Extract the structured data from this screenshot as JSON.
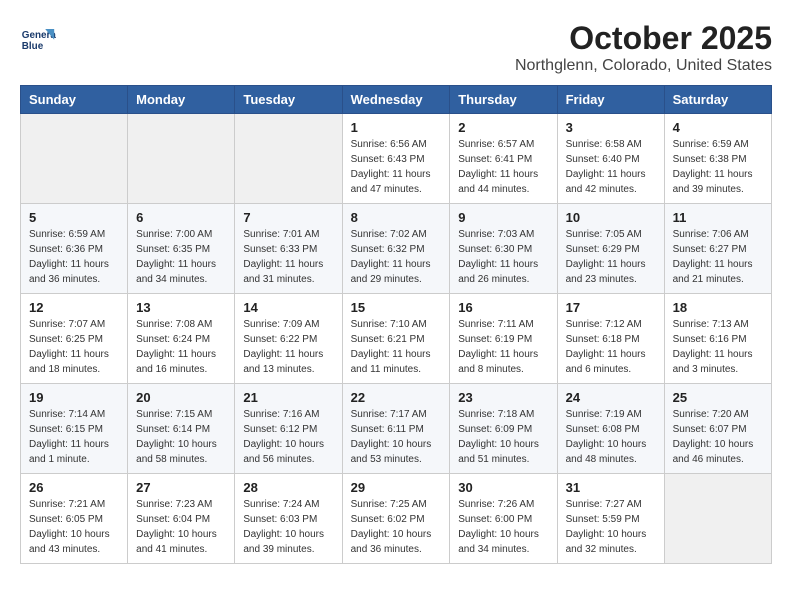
{
  "header": {
    "title": "October 2025",
    "subtitle": "Northglenn, Colorado, United States"
  },
  "logo": {
    "line1": "General",
    "line2": "Blue"
  },
  "days_of_week": [
    "Sunday",
    "Monday",
    "Tuesday",
    "Wednesday",
    "Thursday",
    "Friday",
    "Saturday"
  ],
  "weeks": [
    [
      {
        "day": "",
        "info": ""
      },
      {
        "day": "",
        "info": ""
      },
      {
        "day": "",
        "info": ""
      },
      {
        "day": "1",
        "info": "Sunrise: 6:56 AM\nSunset: 6:43 PM\nDaylight: 11 hours and 47 minutes."
      },
      {
        "day": "2",
        "info": "Sunrise: 6:57 AM\nSunset: 6:41 PM\nDaylight: 11 hours and 44 minutes."
      },
      {
        "day": "3",
        "info": "Sunrise: 6:58 AM\nSunset: 6:40 PM\nDaylight: 11 hours and 42 minutes."
      },
      {
        "day": "4",
        "info": "Sunrise: 6:59 AM\nSunset: 6:38 PM\nDaylight: 11 hours and 39 minutes."
      }
    ],
    [
      {
        "day": "5",
        "info": "Sunrise: 6:59 AM\nSunset: 6:36 PM\nDaylight: 11 hours and 36 minutes."
      },
      {
        "day": "6",
        "info": "Sunrise: 7:00 AM\nSunset: 6:35 PM\nDaylight: 11 hours and 34 minutes."
      },
      {
        "day": "7",
        "info": "Sunrise: 7:01 AM\nSunset: 6:33 PM\nDaylight: 11 hours and 31 minutes."
      },
      {
        "day": "8",
        "info": "Sunrise: 7:02 AM\nSunset: 6:32 PM\nDaylight: 11 hours and 29 minutes."
      },
      {
        "day": "9",
        "info": "Sunrise: 7:03 AM\nSunset: 6:30 PM\nDaylight: 11 hours and 26 minutes."
      },
      {
        "day": "10",
        "info": "Sunrise: 7:05 AM\nSunset: 6:29 PM\nDaylight: 11 hours and 23 minutes."
      },
      {
        "day": "11",
        "info": "Sunrise: 7:06 AM\nSunset: 6:27 PM\nDaylight: 11 hours and 21 minutes."
      }
    ],
    [
      {
        "day": "12",
        "info": "Sunrise: 7:07 AM\nSunset: 6:25 PM\nDaylight: 11 hours and 18 minutes."
      },
      {
        "day": "13",
        "info": "Sunrise: 7:08 AM\nSunset: 6:24 PM\nDaylight: 11 hours and 16 minutes."
      },
      {
        "day": "14",
        "info": "Sunrise: 7:09 AM\nSunset: 6:22 PM\nDaylight: 11 hours and 13 minutes."
      },
      {
        "day": "15",
        "info": "Sunrise: 7:10 AM\nSunset: 6:21 PM\nDaylight: 11 hours and 11 minutes."
      },
      {
        "day": "16",
        "info": "Sunrise: 7:11 AM\nSunset: 6:19 PM\nDaylight: 11 hours and 8 minutes."
      },
      {
        "day": "17",
        "info": "Sunrise: 7:12 AM\nSunset: 6:18 PM\nDaylight: 11 hours and 6 minutes."
      },
      {
        "day": "18",
        "info": "Sunrise: 7:13 AM\nSunset: 6:16 PM\nDaylight: 11 hours and 3 minutes."
      }
    ],
    [
      {
        "day": "19",
        "info": "Sunrise: 7:14 AM\nSunset: 6:15 PM\nDaylight: 11 hours and 1 minute."
      },
      {
        "day": "20",
        "info": "Sunrise: 7:15 AM\nSunset: 6:14 PM\nDaylight: 10 hours and 58 minutes."
      },
      {
        "day": "21",
        "info": "Sunrise: 7:16 AM\nSunset: 6:12 PM\nDaylight: 10 hours and 56 minutes."
      },
      {
        "day": "22",
        "info": "Sunrise: 7:17 AM\nSunset: 6:11 PM\nDaylight: 10 hours and 53 minutes."
      },
      {
        "day": "23",
        "info": "Sunrise: 7:18 AM\nSunset: 6:09 PM\nDaylight: 10 hours and 51 minutes."
      },
      {
        "day": "24",
        "info": "Sunrise: 7:19 AM\nSunset: 6:08 PM\nDaylight: 10 hours and 48 minutes."
      },
      {
        "day": "25",
        "info": "Sunrise: 7:20 AM\nSunset: 6:07 PM\nDaylight: 10 hours and 46 minutes."
      }
    ],
    [
      {
        "day": "26",
        "info": "Sunrise: 7:21 AM\nSunset: 6:05 PM\nDaylight: 10 hours and 43 minutes."
      },
      {
        "day": "27",
        "info": "Sunrise: 7:23 AM\nSunset: 6:04 PM\nDaylight: 10 hours and 41 minutes."
      },
      {
        "day": "28",
        "info": "Sunrise: 7:24 AM\nSunset: 6:03 PM\nDaylight: 10 hours and 39 minutes."
      },
      {
        "day": "29",
        "info": "Sunrise: 7:25 AM\nSunset: 6:02 PM\nDaylight: 10 hours and 36 minutes."
      },
      {
        "day": "30",
        "info": "Sunrise: 7:26 AM\nSunset: 6:00 PM\nDaylight: 10 hours and 34 minutes."
      },
      {
        "day": "31",
        "info": "Sunrise: 7:27 AM\nSunset: 5:59 PM\nDaylight: 10 hours and 32 minutes."
      },
      {
        "day": "",
        "info": ""
      }
    ]
  ]
}
